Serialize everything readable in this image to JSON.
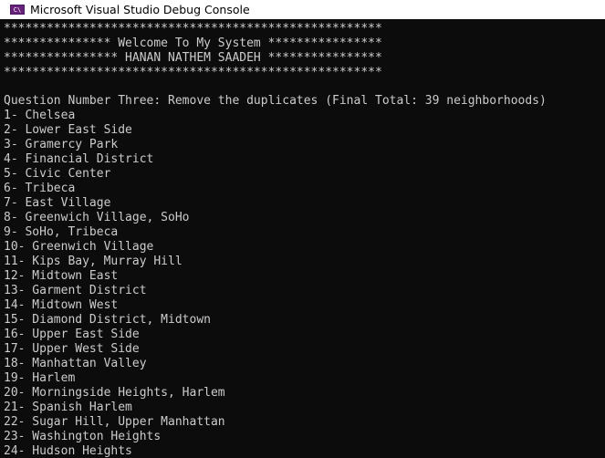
{
  "window": {
    "title": "Microsoft Visual Studio Debug Console",
    "icon": "vs-debug-console-icon",
    "icon_glyph": "C\\",
    "accent": "#68217a"
  },
  "console": {
    "background": "#0c0c0c",
    "foreground": "#cccccc",
    "banner": [
      "*****************************************************",
      "*************** Welcome To My System ****************",
      "**************** HANAN NATHEM SAADEH ****************",
      "*****************************************************"
    ],
    "question": "Question Number Three: Remove the duplicates (Final Total: 39 neighborhoods)",
    "items": [
      "1- Chelsea",
      "2- Lower East Side",
      "3- Gramercy Park",
      "4- Financial District",
      "5- Civic Center",
      "6- Tribeca",
      "7- East Village",
      "8- Greenwich Village, SoHo",
      "9- SoHo, Tribeca",
      "10- Greenwich Village",
      "11- Kips Bay, Murray Hill",
      "12- Midtown East",
      "13- Garment District",
      "14- Midtown West",
      "15- Diamond District, Midtown",
      "16- Upper East Side",
      "17- Upper West Side",
      "18- Manhattan Valley",
      "19- Harlem",
      "20- Morningside Heights, Harlem",
      "21- Spanish Harlem",
      "22- Sugar Hill, Upper Manhattan",
      "23- Washington Heights",
      "24- Hudson Heights"
    ]
  }
}
